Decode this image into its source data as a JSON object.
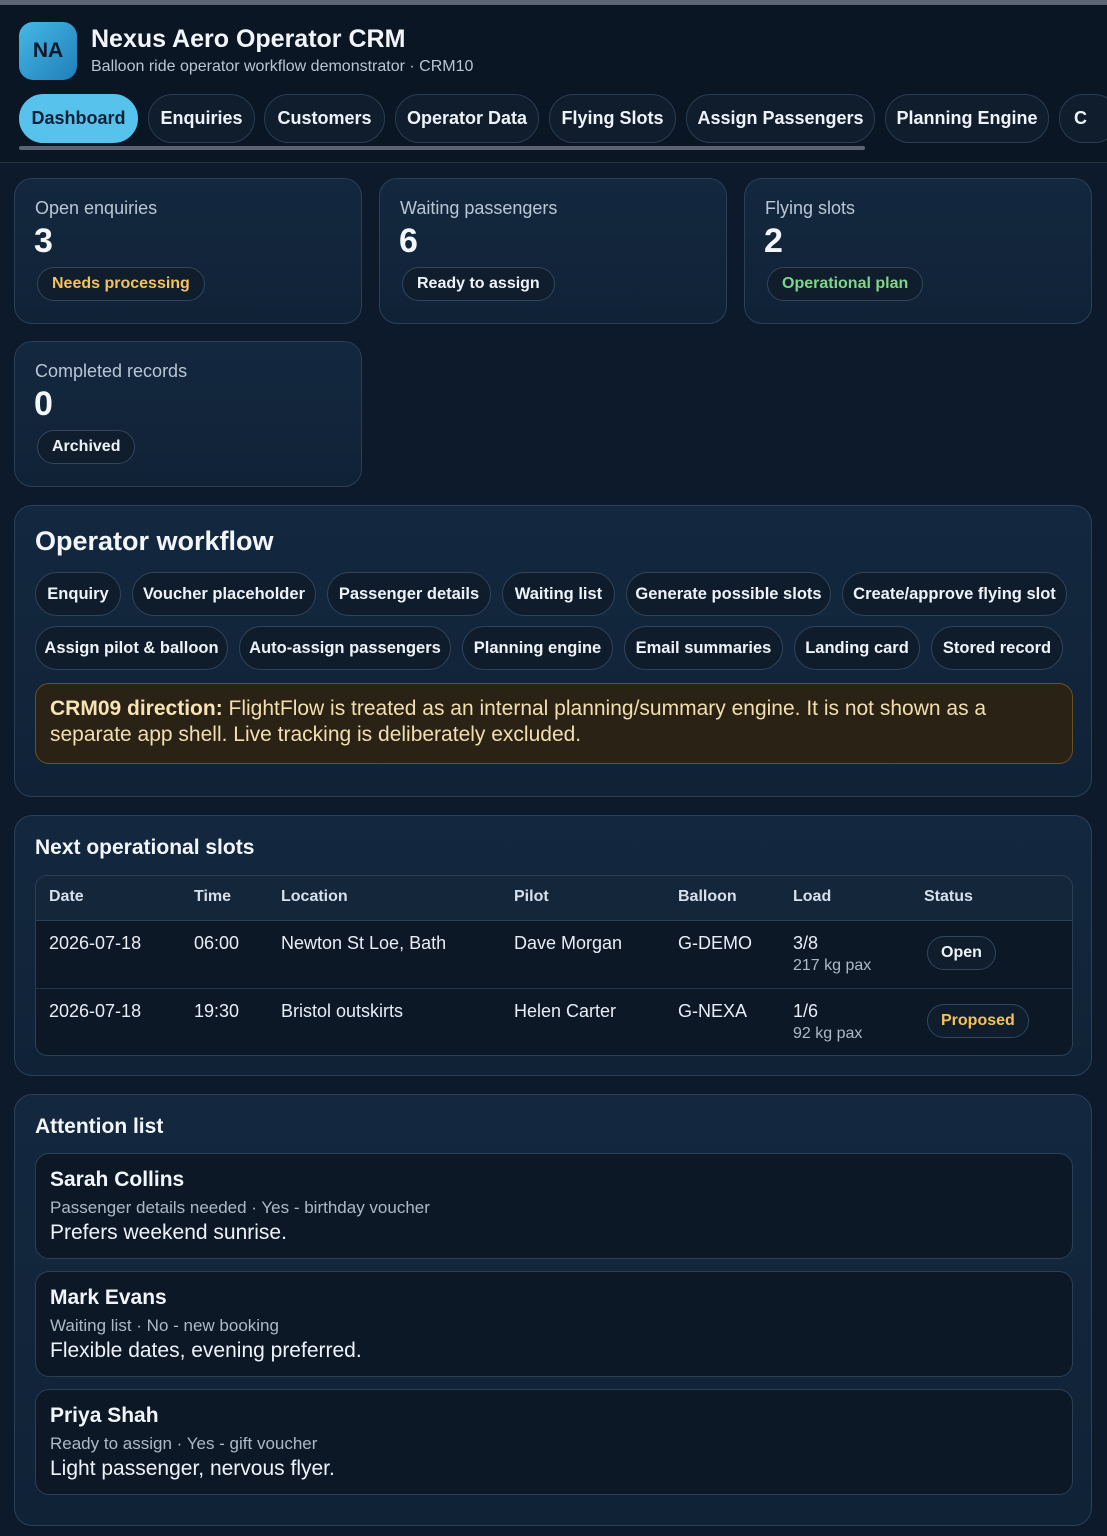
{
  "app": {
    "logo": "NA",
    "title": "Nexus Aero Operator CRM",
    "subtitle": "Balloon ride operator workflow demonstrator · CRM10"
  },
  "tabs": [
    {
      "label": "Dashboard",
      "active": true
    },
    {
      "label": "Enquiries"
    },
    {
      "label": "Customers"
    },
    {
      "label": "Operator Data"
    },
    {
      "label": "Flying Slots"
    },
    {
      "label": "Assign Passengers"
    },
    {
      "label": "Planning Engine"
    },
    {
      "label": "C"
    }
  ],
  "stats": [
    {
      "label": "Open enquiries",
      "value": "3",
      "badge": "Needs processing",
      "badge_color": "#f4c25c"
    },
    {
      "label": "Waiting passengers",
      "value": "6",
      "badge": "Ready to assign",
      "badge_color": "#eef3f9"
    },
    {
      "label": "Flying slots",
      "value": "2",
      "badge": "Operational plan",
      "badge_color": "#7fd68a"
    },
    {
      "label": "Completed records",
      "value": "0",
      "badge": "Archived",
      "badge_color": "#eef3f9"
    }
  ],
  "workflow": {
    "title": "Operator workflow",
    "steps": [
      "Enquiry",
      "Voucher placeholder",
      "Passenger details",
      "Waiting list",
      "Generate possible slots",
      "Create/approve flying slot",
      "Assign pilot & balloon",
      "Auto-assign passengers",
      "Planning engine",
      "Email summaries",
      "Landing card",
      "Stored record"
    ],
    "notice_label": "CRM09 direction:",
    "notice_text": " FlightFlow is treated as an internal planning/summary engine. It is not shown as a separate app shell. Live tracking is deliberately excluded."
  },
  "slots": {
    "title": "Next operational slots",
    "columns": [
      "Date",
      "Time",
      "Location",
      "Pilot",
      "Balloon",
      "Load",
      "Status"
    ],
    "rows": [
      {
        "date": "2026-07-18",
        "time": "06:00",
        "location": "Newton St Loe, Bath",
        "pilot": "Dave Morgan",
        "balloon": "G-DEMO",
        "load": "3/8",
        "load_sub": "217 kg pax",
        "status": "Open",
        "status_color": "#eef3f9"
      },
      {
        "date": "2026-07-18",
        "time": "19:30",
        "location": "Bristol outskirts",
        "pilot": "Helen Carter",
        "balloon": "G-NEXA",
        "load": "1/6",
        "load_sub": "92 kg pax",
        "status": "Proposed",
        "status_color": "#f4c25c"
      }
    ]
  },
  "attention": {
    "title": "Attention list",
    "items": [
      {
        "name": "Sarah Collins",
        "meta": "Passenger details needed · Yes - birthday voucher",
        "note": "Prefers weekend sunrise."
      },
      {
        "name": "Mark Evans",
        "meta": "Waiting list · No - new booking",
        "note": "Flexible dates, evening preferred."
      },
      {
        "name": "Priya Shah",
        "meta": "Ready to assign · Yes - gift voucher",
        "note": "Light passenger, nervous flyer."
      }
    ]
  }
}
